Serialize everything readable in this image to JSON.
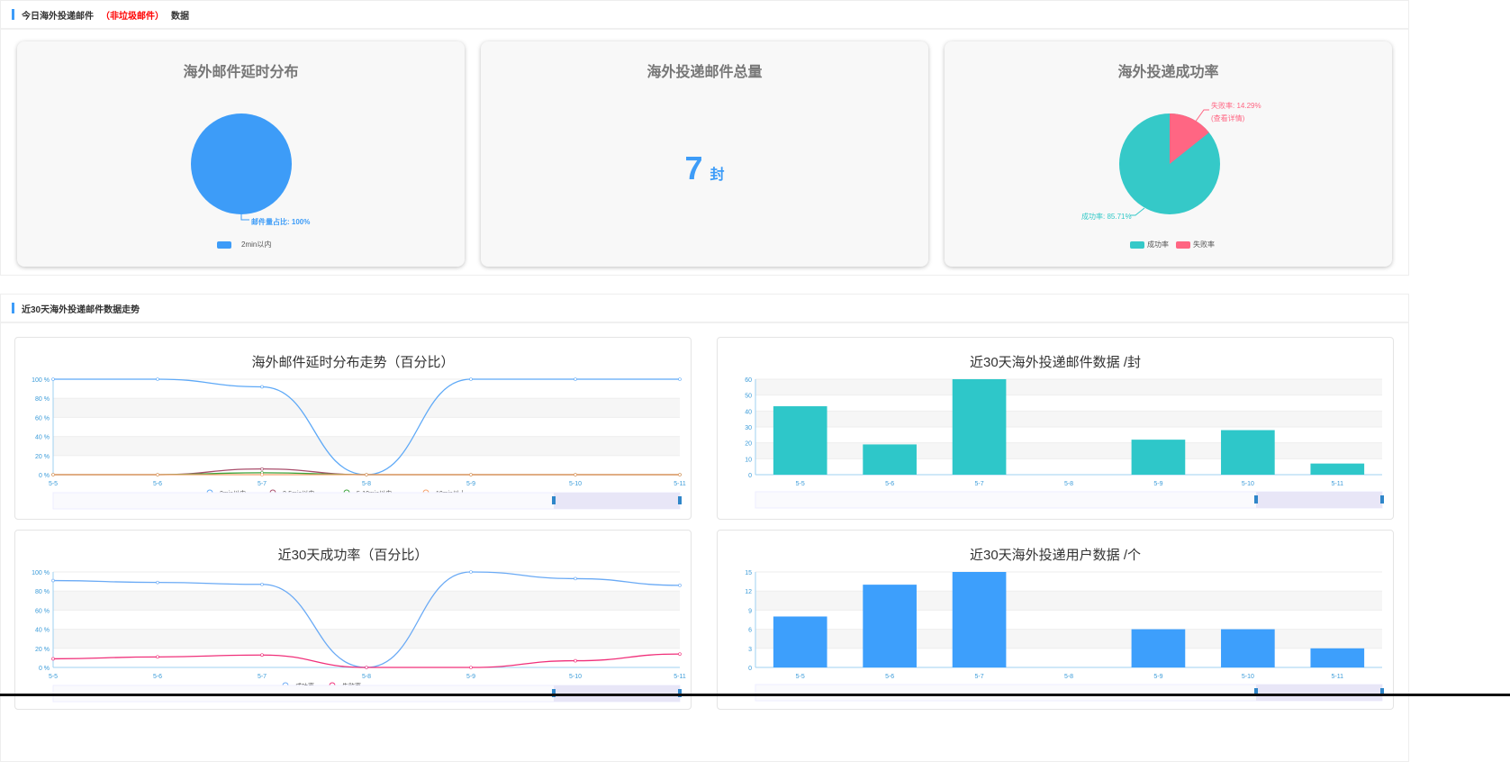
{
  "section1": {
    "title": "今日海外投递邮件",
    "highlight": "（非垃圾邮件）",
    "suffix": "数据"
  },
  "card_delay": {
    "title": "海外邮件延时分布",
    "label": "邮件量占比: 100%",
    "legend": "2min以内",
    "color": "#3d9cf8"
  },
  "card_total": {
    "title": "海外投递邮件总量",
    "value": "7",
    "unit": "封"
  },
  "card_success": {
    "title": "海外投递成功率",
    "fail_label": "失败率: 14.29%",
    "fail_link": "(查看详情)",
    "success_label": "成功率: 85.71%",
    "legend": [
      "成功率",
      "失败率"
    ],
    "colors": [
      "#35c9c8",
      "#ff6683"
    ],
    "success": 85.71,
    "fail": 14.29
  },
  "section2": {
    "title": "近30天海外投递邮件数据走势"
  },
  "chart_data": [
    {
      "type": "line",
      "title": "海外邮件延时分布走势（百分比）",
      "categories": [
        "5-5",
        "5-6",
        "5-7",
        "5-8",
        "5-9",
        "5-10",
        "5-11"
      ],
      "yticks": [
        "0 %",
        "20 %",
        "40 %",
        "60 %",
        "80 %",
        "100 %"
      ],
      "ylim": [
        0,
        100
      ],
      "series": [
        {
          "name": "2min以内",
          "color": "#5ea9f7",
          "values": [
            100,
            100,
            92,
            0,
            100,
            100,
            100
          ]
        },
        {
          "name": "2-5min以内",
          "color": "#a94d6b",
          "values": [
            0,
            0,
            6,
            0,
            0,
            0,
            0
          ]
        },
        {
          "name": "5-10min以内",
          "color": "#3aa33a",
          "values": [
            0,
            0,
            2,
            0,
            0,
            0,
            0
          ]
        },
        {
          "name": "10min以上",
          "color": "#f5a06a",
          "values": [
            0,
            0,
            0,
            0,
            0,
            0,
            0
          ]
        }
      ]
    },
    {
      "type": "bar",
      "title": "近30天海外投递邮件数据 /封",
      "categories": [
        "5-5",
        "5-6",
        "5-7",
        "5-8",
        "5-9",
        "5-10",
        "5-11"
      ],
      "yticks": [
        "0",
        "10",
        "20",
        "30",
        "40",
        "50",
        "60"
      ],
      "ylim": [
        0,
        60
      ],
      "color": "#2ec7c9",
      "values": [
        43,
        19,
        60,
        0,
        22,
        28,
        7
      ]
    },
    {
      "type": "line",
      "title": "近30天成功率（百分比）",
      "categories": [
        "5-5",
        "5-6",
        "5-7",
        "5-8",
        "5-9",
        "5-10",
        "5-11"
      ],
      "yticks": [
        "0 %",
        "20 %",
        "40 %",
        "60 %",
        "80 %",
        "100 %"
      ],
      "ylim": [
        0,
        100
      ],
      "series": [
        {
          "name": "成功率",
          "color": "#6aaaf5",
          "values": [
            91,
            89,
            87,
            0,
            100,
            93,
            86
          ]
        },
        {
          "name": "失败率",
          "color": "#f0307a",
          "values": [
            9,
            11,
            13,
            0,
            0,
            7,
            14
          ]
        }
      ]
    },
    {
      "type": "bar",
      "title": "近30天海外投递用户数据 /个",
      "categories": [
        "5-5",
        "5-6",
        "5-7",
        "5-8",
        "5-9",
        "5-10",
        "5-11"
      ],
      "yticks": [
        "0",
        "3",
        "6",
        "9",
        "12",
        "15"
      ],
      "ylim": [
        0,
        15
      ],
      "color": "#3d9ffc",
      "values": [
        8,
        13,
        15,
        0,
        6,
        6,
        3
      ]
    }
  ]
}
